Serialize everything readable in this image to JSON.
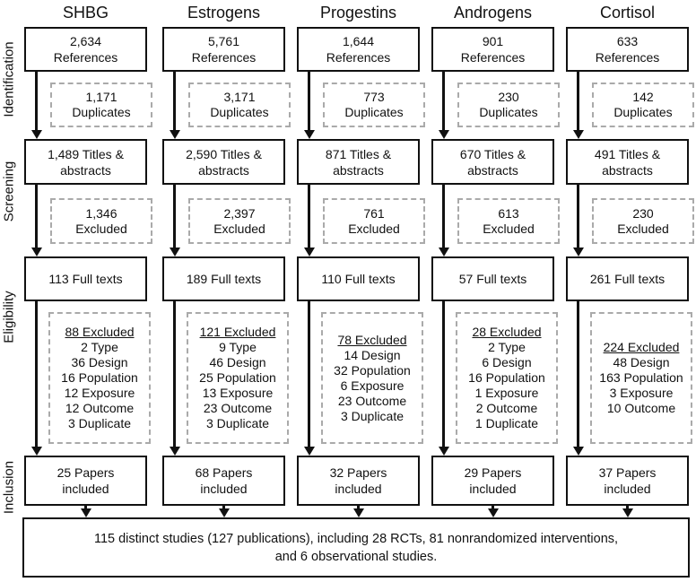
{
  "stages": [
    "Identification",
    "Screening",
    "Eligibility",
    "Inclusion"
  ],
  "columns": [
    {
      "name": "SHBG",
      "references": [
        "2,634",
        "References"
      ],
      "duplicates": [
        "1,171",
        "Duplicates"
      ],
      "screening": [
        "1,489 Titles &",
        "abstracts"
      ],
      "excluded": [
        "1,346",
        "Excluded"
      ],
      "full_texts": "113 Full texts",
      "eligibility_excluded": {
        "title": "88 Excluded",
        "reasons": [
          "2 Type",
          "36 Design",
          "16 Population",
          "12 Exposure",
          "12 Outcome",
          "3 Duplicate"
        ]
      },
      "included": [
        "25 Papers",
        "included"
      ]
    },
    {
      "name": "Estrogens",
      "references": [
        "5,761",
        "References"
      ],
      "duplicates": [
        "3,171",
        "Duplicates"
      ],
      "screening": [
        "2,590 Titles &",
        "abstracts"
      ],
      "excluded": [
        "2,397",
        "Excluded"
      ],
      "full_texts": "189 Full texts",
      "eligibility_excluded": {
        "title": "121 Excluded",
        "reasons": [
          "9 Type",
          "46 Design",
          "25 Population",
          "13 Exposure",
          "23 Outcome",
          "3 Duplicate"
        ]
      },
      "included": [
        "68 Papers",
        "included"
      ]
    },
    {
      "name": "Progestins",
      "references": [
        "1,644",
        "References"
      ],
      "duplicates": [
        "773",
        "Duplicates"
      ],
      "screening": [
        "871 Titles &",
        "abstracts"
      ],
      "excluded": [
        "761",
        "Excluded"
      ],
      "full_texts": "110 Full texts",
      "eligibility_excluded": {
        "title": "78 Excluded",
        "reasons": [
          "14 Design",
          "32 Population",
          "6 Exposure",
          "23 Outcome",
          "3 Duplicate"
        ]
      },
      "included": [
        "32 Papers",
        "included"
      ]
    },
    {
      "name": "Androgens",
      "references": [
        "901",
        "References"
      ],
      "duplicates": [
        "230",
        "Duplicates"
      ],
      "screening": [
        "670 Titles &",
        "abstracts"
      ],
      "excluded": [
        "613",
        "Excluded"
      ],
      "full_texts": "57 Full texts",
      "eligibility_excluded": {
        "title": "28 Excluded",
        "reasons": [
          "2 Type",
          "6 Design",
          "16 Population",
          "1 Exposure",
          "2 Outcome",
          "1 Duplicate"
        ]
      },
      "included": [
        "29 Papers",
        "included"
      ]
    },
    {
      "name": "Cortisol",
      "references": [
        "633",
        "References"
      ],
      "duplicates": [
        "142",
        "Duplicates"
      ],
      "screening": [
        "491 Titles &",
        "abstracts"
      ],
      "excluded": [
        "230",
        "Excluded"
      ],
      "full_texts": "261 Full texts",
      "eligibility_excluded": {
        "title": "224 Excluded",
        "reasons": [
          "48 Design",
          "163 Population",
          "3 Exposure",
          "10 Outcome"
        ]
      },
      "included": [
        "37 Papers",
        "included"
      ]
    }
  ],
  "summary": [
    "115 distinct studies (127 publications), including 28 RCTs, 81 nonrandomized interventions,",
    "and 6 observational studies."
  ]
}
